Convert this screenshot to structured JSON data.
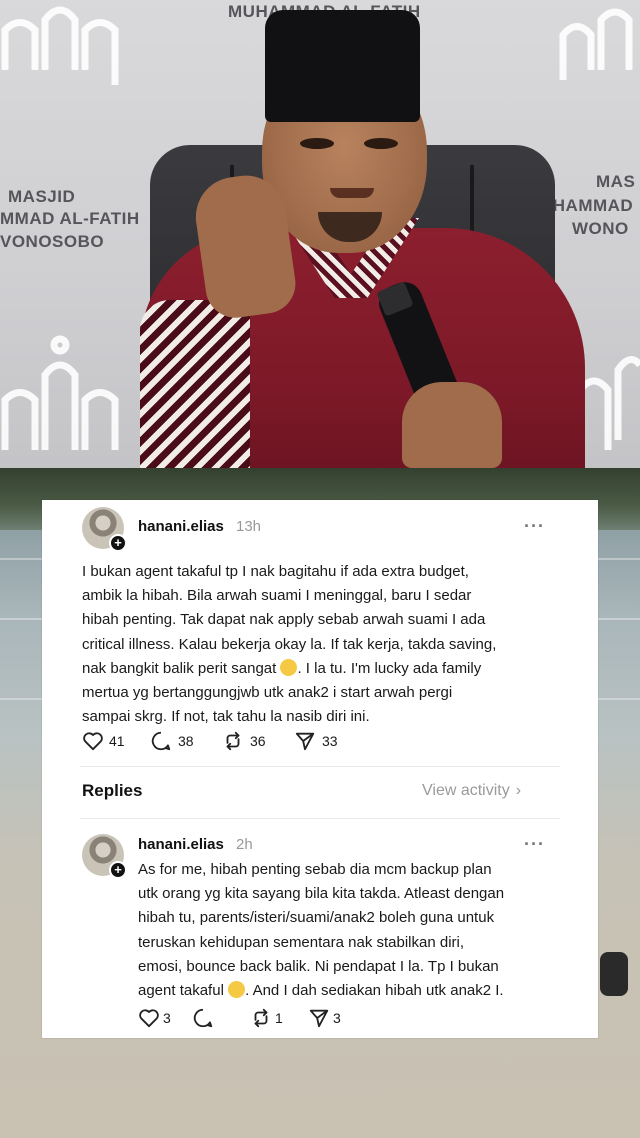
{
  "video_frame": {
    "backdrop_texts": [
      "MUHAMMAD AL-FATIH",
      "MASJID",
      "MMAD AL-FATIH",
      "VONOSOBO",
      "MAS",
      "UHAMMAD",
      "WONO"
    ]
  },
  "post": {
    "username": "hanani.elias",
    "time": "13h",
    "lines": [
      "I bukan agent takaful tp I nak bagitahu if ada extra budget,",
      "ambik la hibah. Bila arwah suami I meninggal, baru I sedar",
      "hibah penting. Tak dapat nak apply sebab arwah suami I ada",
      "critical illness. Kalau bekerja okay la. If tak kerja, takda saving,",
      "nak bangkit balik perit sangat",
      ". I la tu. I'm lucky ada family",
      "mertua yg bertanggungjwb utk anak2 i start arwah pergi",
      "sampai skrg. If not, tak tahu la nasib diri ini."
    ],
    "emoji": "pleading-face-emoji",
    "likes": "41",
    "comments": "38",
    "reposts": "36",
    "shares": "33"
  },
  "replies_header": {
    "title": "Replies",
    "view_activity": "View activity"
  },
  "reply": {
    "username": "hanani.elias",
    "time": "2h",
    "lines": [
      "As for me, hibah penting sebab dia mcm backup plan",
      "utk orang yg kita sayang bila kita takda. Atleast dengan",
      "hibah tu, parents/isteri/suami/anak2 boleh guna untuk",
      "teruskan kehidupan sementara nak stabilkan diri,",
      "emosi, bounce back balik. Ni pendapat I la. Tp I bukan",
      "agent takaful",
      ". And I dah sediakan hibah utk anak2 I."
    ],
    "emoji": "sweat-smile-emoji",
    "likes": "3",
    "comments": "",
    "reposts": "1",
    "shares": "3"
  },
  "colors": {
    "robe": "#8c1f2e",
    "card_bg": "#ffffff",
    "muted_text": "#999999"
  }
}
